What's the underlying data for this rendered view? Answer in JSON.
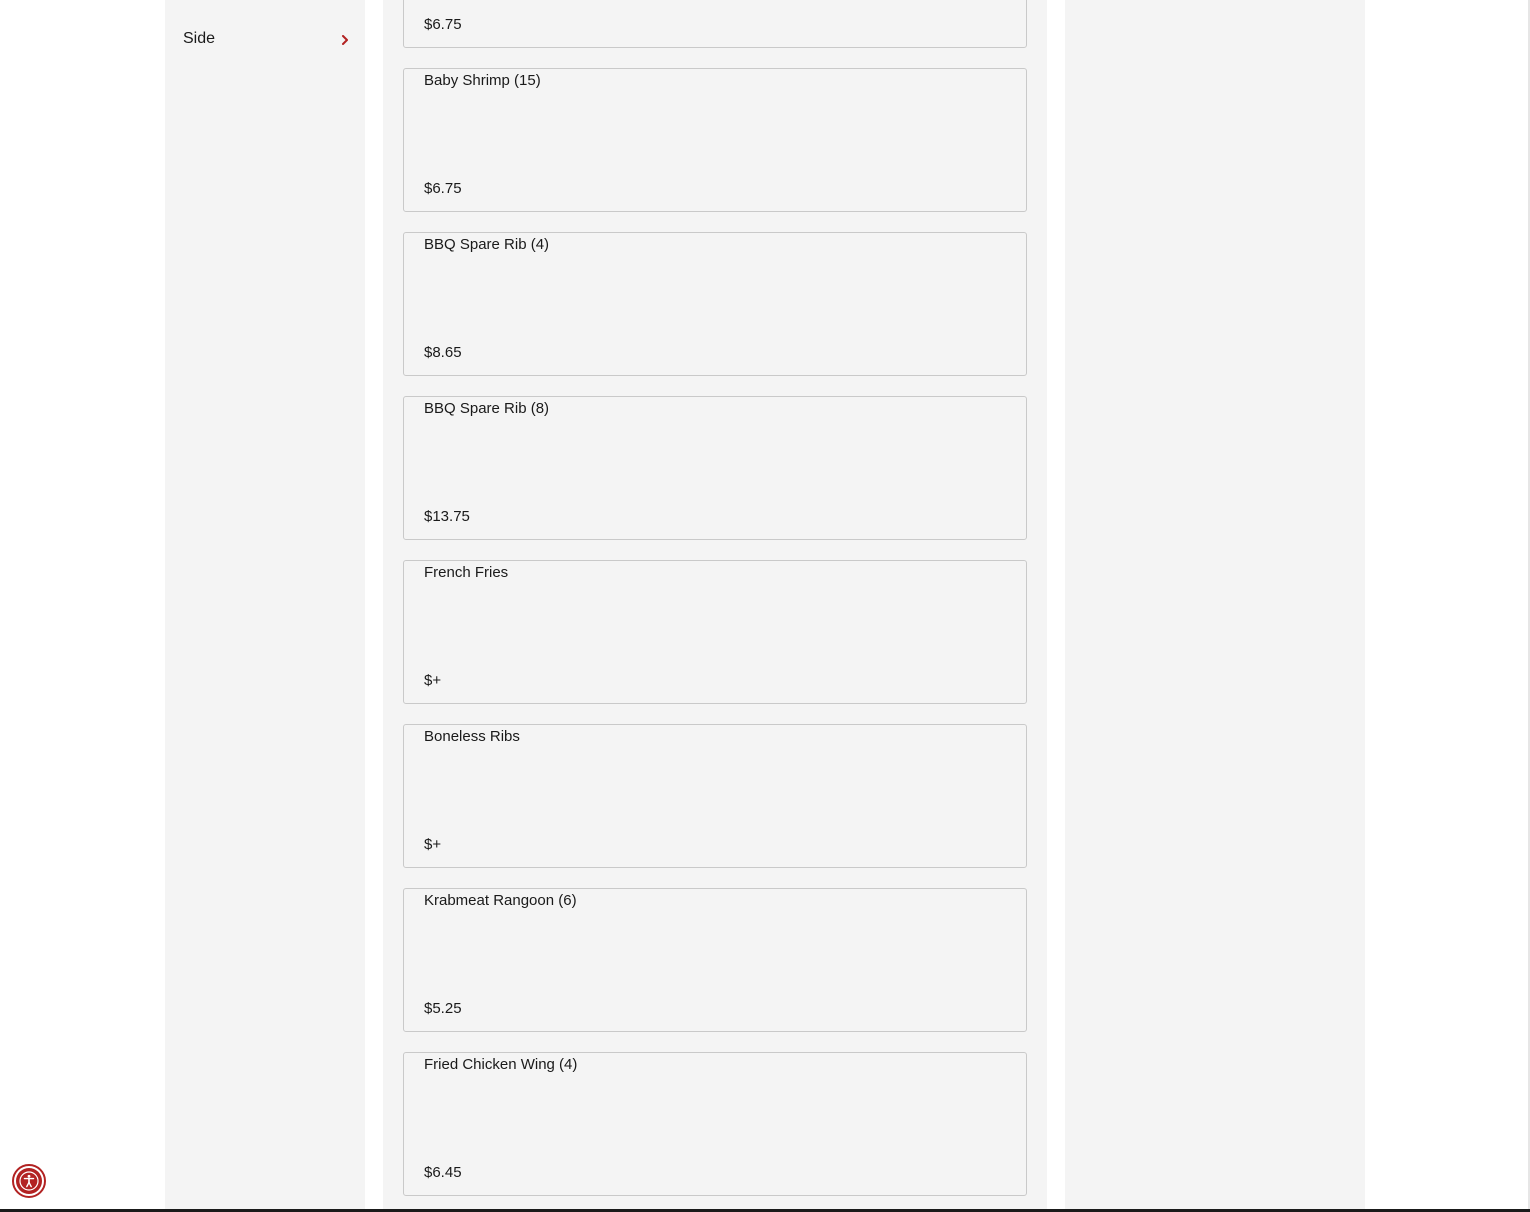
{
  "sidebar": {
    "items": [
      {
        "label": "Side"
      }
    ]
  },
  "menu": {
    "items": [
      {
        "name": "",
        "price": "$6.75"
      },
      {
        "name": "Baby Shrimp (15)",
        "price": "$6.75"
      },
      {
        "name": "BBQ Spare Rib (4)",
        "price": "$8.65"
      },
      {
        "name": "BBQ Spare Rib (8)",
        "price": "$13.75"
      },
      {
        "name": "French Fries",
        "price": "$+"
      },
      {
        "name": "Boneless Ribs",
        "price": "$+"
      },
      {
        "name": "Krabmeat Rangoon (6)",
        "price": "$5.25"
      },
      {
        "name": "Fried Chicken Wing (4)",
        "price": "$6.45"
      }
    ]
  },
  "colors": {
    "accent": "#b22222",
    "panel": "#f4f4f4",
    "card_border": "#c9c9c9"
  },
  "icons": {
    "sidebar_chevron": "chevron-right-icon",
    "accessibility": "accessibility-icon"
  }
}
